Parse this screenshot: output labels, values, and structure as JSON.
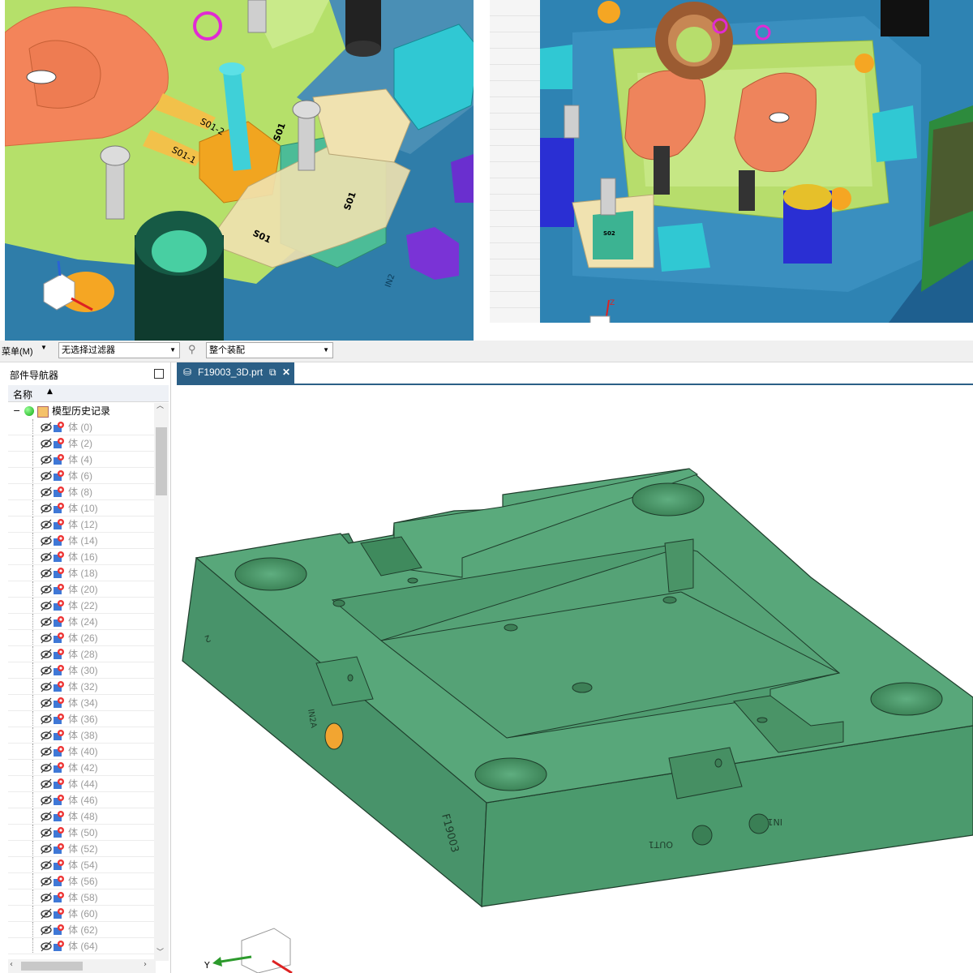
{
  "toolbar": {
    "menu_label": "菜单(M)",
    "filter_value": "无选择过滤器",
    "scope_value": "整个装配"
  },
  "navigator": {
    "title": "部件导航器",
    "column_name": "名称",
    "root_label": "模型历史记录",
    "bodies": [
      "体 (0)",
      "体 (2)",
      "体 (4)",
      "体 (6)",
      "体 (8)",
      "体 (10)",
      "体 (12)",
      "体 (14)",
      "体 (16)",
      "体 (18)",
      "体 (20)",
      "体 (22)",
      "体 (24)",
      "体 (26)",
      "体 (28)",
      "体 (30)",
      "体 (32)",
      "体 (34)",
      "体 (36)",
      "体 (38)",
      "体 (40)",
      "体 (42)",
      "体 (44)",
      "体 (46)",
      "体 (48)",
      "体 (50)",
      "体 (52)",
      "体 (54)",
      "体 (56)",
      "体 (58)",
      "体 (60)",
      "体 (62)",
      "体 (64)"
    ]
  },
  "viewport": {
    "tab_title": "F19003_3D.prt",
    "part_marks": {
      "id": "F19003",
      "in": "IN1",
      "out": "OUT1",
      "side": "IN2A",
      "num": "2"
    },
    "triad_y": "Y"
  },
  "top_left_labels": {
    "s01_2": "S01-2",
    "s01_1": "S01-1",
    "s01_a": "S01",
    "s01_b": "S01",
    "s01_c": "S01",
    "in2": "IN2"
  },
  "top_right_labels": {
    "s02": "S02",
    "z": "Z"
  },
  "colors": {
    "plate": "#4e9a6e",
    "water": "#2f7da9",
    "tab": "#2b5f86",
    "hole": "#f2a531"
  }
}
